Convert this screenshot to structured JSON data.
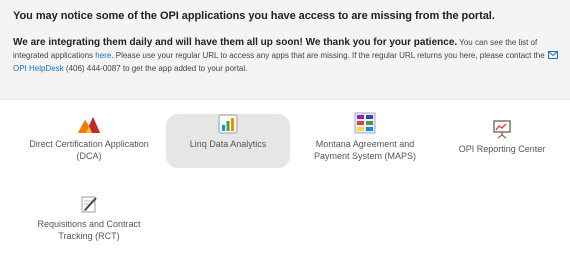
{
  "notice": {
    "headline": "You may notice some of the OPI applications you have access to are missing from the portal.",
    "strong": "We are integrating them daily and will have them all up soon! We thank you for your patience.",
    "text1": " You can see the list of integrated applications ",
    "link_here": "here",
    "text2": ". Please use your regular URL to access any apps that are missing. If the regular URL returns you here, please contact the ",
    "link_helpdesk": "OPI HelpDesk",
    "text3": " (406) 444-0087 to get the app added to your portal.",
    "link_color": "#1a73c9"
  },
  "apps": [
    {
      "label": "Direct Certification Application (DCA)",
      "icon": "triangle-logo-icon",
      "selected": false
    },
    {
      "label": "Linq Data Analytics",
      "icon": "bar-chart-icon",
      "selected": true
    },
    {
      "label": "Montana Agreement and Payment System (MAPS)",
      "icon": "grid-dashboard-icon",
      "selected": false
    },
    {
      "label": "OPI Reporting Center",
      "icon": "presentation-board-icon",
      "selected": false
    },
    {
      "label": "Requisitions and Contract Tracking (RCT)",
      "icon": "notepad-pencil-icon",
      "selected": false
    }
  ]
}
